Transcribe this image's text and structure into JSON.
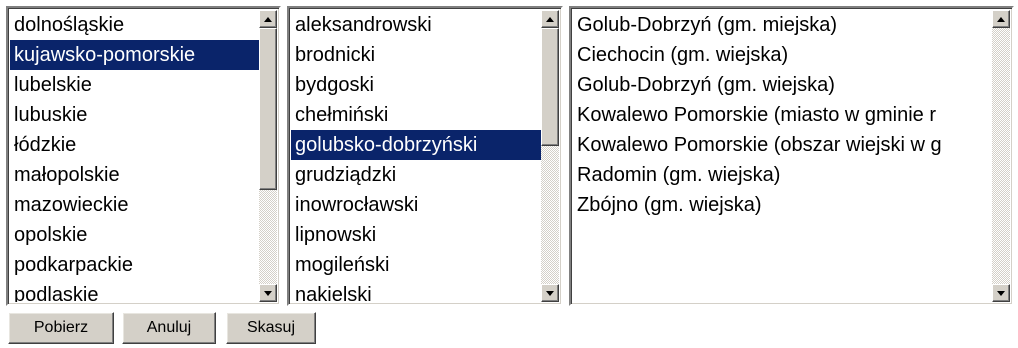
{
  "lists": {
    "voivodeships": {
      "selected_index": 1,
      "items": [
        "dolnośląskie",
        "kujawsko-pomorskie",
        "lubelskie",
        "lubuskie",
        "łódzkie",
        "małopolskie",
        "mazowieckie",
        "opolskie",
        "podkarpackie",
        "podlaskie"
      ]
    },
    "counties": {
      "selected_index": 4,
      "items": [
        "aleksandrowski",
        "brodnicki",
        "bydgoski",
        "chełmiński",
        "golubsko-dobrzyński",
        "grudziądzki",
        "inowrocławski",
        "lipnowski",
        "mogileński",
        "nakielski"
      ]
    },
    "communes": {
      "selected_index": -1,
      "items": [
        "Golub-Dobrzyń (gm. miejska)",
        "Ciechocin (gm. wiejska)",
        "Golub-Dobrzyń (gm. wiejska)",
        "Kowalewo Pomorskie (miasto w gminie r",
        "Kowalewo Pomorskie (obszar wiejski w g",
        "Radomin (gm. wiejska)",
        "Zbójno (gm. wiejska)"
      ]
    }
  },
  "buttons": {
    "fetch": "Pobierz",
    "cancel": "Anuluj",
    "clear": "Skasuj"
  }
}
